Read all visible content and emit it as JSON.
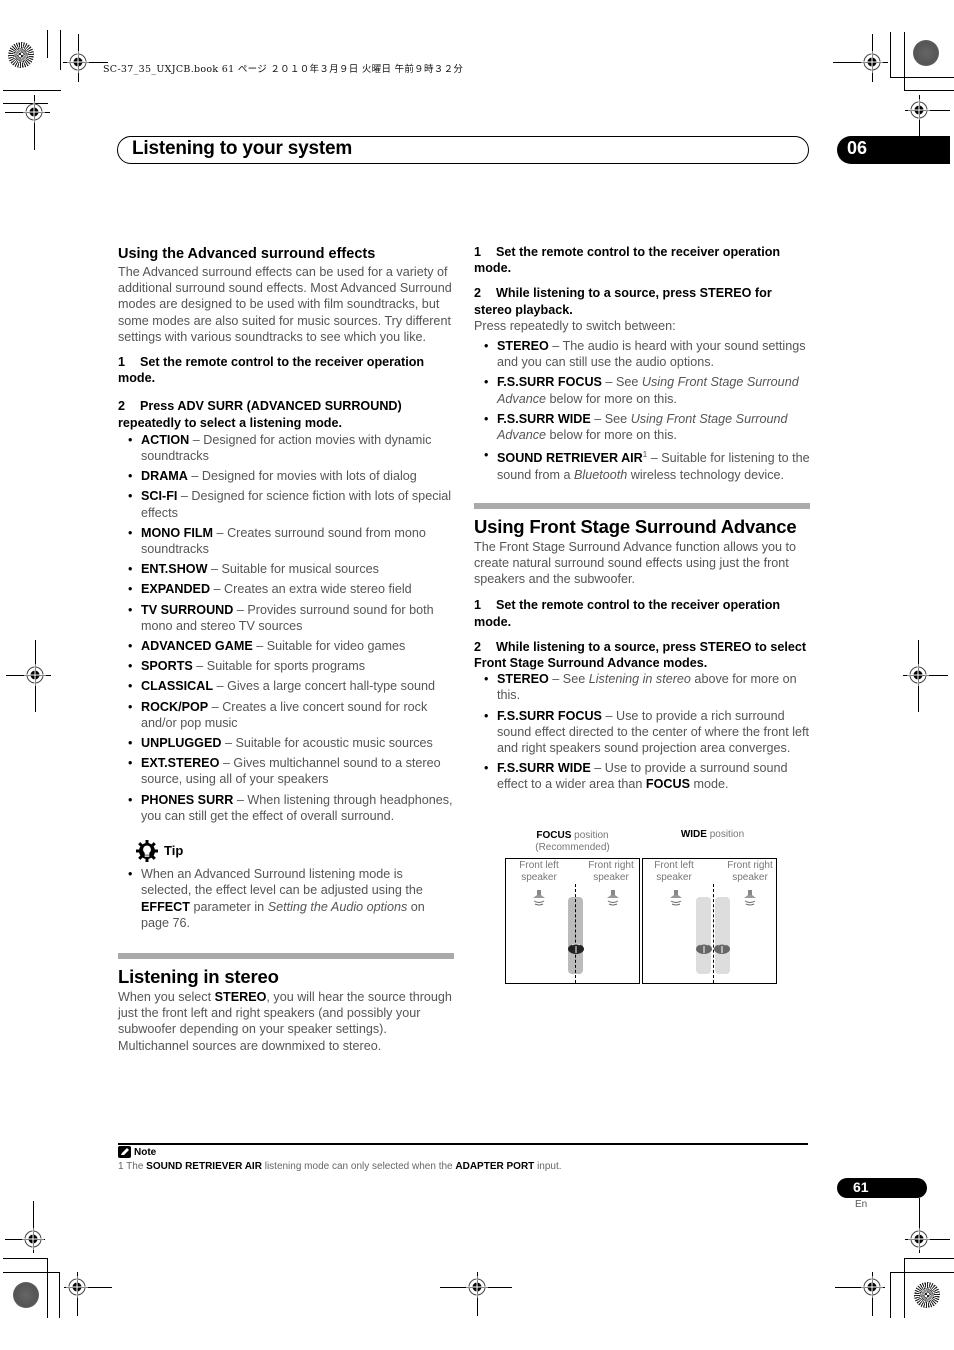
{
  "print_info": "SC-37_35_UXJCB.book  61 ページ  ２０１０年３月９日  火曜日  午前９時３２分",
  "header": {
    "title": "Listening to your system",
    "chapter": "06"
  },
  "left": {
    "adv_heading": "Using the Advanced surround effects",
    "adv_intro": "The Advanced surround effects can be used for a variety of additional surround sound effects. Most Advanced Surround modes are designed to be used with film soundtracks, but some modes are also suited for music sources. Try different settings with various soundtracks to see which you like.",
    "step1_num": "1",
    "step1": "Set the remote control to the receiver operation mode.",
    "step2_num": "2",
    "step2": "Press ADV SURR (ADVANCED SURROUND) repeatedly to select a listening mode.",
    "modes": [
      {
        "name": "ACTION",
        "desc": " – Designed for action movies with dynamic soundtracks"
      },
      {
        "name": "DRAMA",
        "desc": " – Designed for movies with lots of dialog"
      },
      {
        "name": "SCI-FI",
        "desc": " – Designed for science fiction with lots of special effects"
      },
      {
        "name": "MONO FILM",
        "desc": " – Creates surround sound from mono soundtracks"
      },
      {
        "name": "ENT.SHOW",
        "desc": " – Suitable for musical sources"
      },
      {
        "name": "EXPANDED",
        "desc": " – Creates an extra wide stereo field"
      },
      {
        "name": "TV SURROUND",
        "desc": " – Provides surround sound for both mono and stereo TV sources"
      },
      {
        "name": "ADVANCED GAME",
        "desc": " – Suitable for video games"
      },
      {
        "name": "SPORTS",
        "desc": " – Suitable for sports programs"
      },
      {
        "name": "CLASSICAL",
        "desc": " – Gives a large concert hall-type sound"
      },
      {
        "name": "ROCK/POP",
        "desc": " – Creates a live concert sound for rock and/or pop music"
      },
      {
        "name": "UNPLUGGED",
        "desc": " – Suitable for acoustic music sources"
      },
      {
        "name": "EXT.STEREO",
        "desc": " – Gives multichannel sound to a stereo source, using all of your speakers"
      },
      {
        "name": "PHONES SURR",
        "desc": " – When listening through headphones, you can still get the effect of overall surround."
      }
    ],
    "tip": {
      "label": "Tip",
      "text_1": "When an Advanced Surround listening mode is selected, the effect level can be adjusted using the ",
      "bold": "EFFECT",
      "text_2": " parameter in ",
      "link": "Setting the Audio options",
      "text_3": " on page 76."
    },
    "stereo_heading": "Listening in stereo",
    "stereo_text_1": "When you select ",
    "stereo_bold": "STEREO",
    "stereo_text_2": ", you will hear the source through just the front left and right speakers (and possibly your subwoofer depending on your speaker settings). Multichannel sources are downmixed to stereo."
  },
  "right": {
    "step1_num": "1",
    "step1": "Set the remote control to the receiver operation mode.",
    "step2_num": "2",
    "step2": "While listening to a source, press STEREO for stereo playback.",
    "press_text": "Press repeatedly to switch between:",
    "stereo_modes": [
      {
        "name": "STEREO",
        "desc": " – The audio is heard with your sound settings and you can still use the audio options."
      },
      {
        "name": "F.S.SURR FOCUS",
        "desc_1": " – See ",
        "link": "Using Front Stage Surround Advance",
        "desc_2": " below for more on this."
      },
      {
        "name": "F.S.SURR WIDE",
        "desc_1": " – See ",
        "link": "Using Front Stage Surround Advance",
        "desc_2": " below for more on this."
      },
      {
        "name": "SOUND RETRIEVER AIR",
        "sup": "1",
        "desc_1": " – Suitable for listening to the sound from a ",
        "link": "Bluetooth",
        "desc_2": " wireless technology device."
      }
    ],
    "fssa_heading": "Using Front Stage Surround Advance",
    "fssa_intro": "The Front Stage Surround Advance function allows you to create natural surround sound effects using just the front speakers and the subwoofer.",
    "fssa_step1_num": "1",
    "fssa_step1": "Set the remote control to the receiver operation mode.",
    "fssa_step2_num": "2",
    "fssa_step2": "While listening to a source, press STEREO to select Front Stage Surround Advance modes.",
    "fssa_modes": [
      {
        "name": "STEREO",
        "desc_1": " – See ",
        "link": "Listening in stereo",
        "desc_2": " above for more on this."
      },
      {
        "name": "F.S.SURR FOCUS",
        "desc_1": " – Use to provide a rich surround sound effect directed to the center of where the front left and right speakers sound projection area converges."
      },
      {
        "name": "F.S.SURR WIDE",
        "desc_1": " – Use to provide a surround sound effect to a wider area than ",
        "bold": "FOCUS",
        "desc_2": " mode."
      }
    ]
  },
  "diagram": {
    "focus_caption_bold": "FOCUS",
    "focus_caption": " position",
    "focus_caption_sub": "(Recommended)",
    "wide_caption_bold": "WIDE",
    "wide_caption": " position",
    "front_left_1": "Front left",
    "front_left_2": "speaker",
    "front_right_1": "Front right",
    "front_right_2": "speaker"
  },
  "footer": {
    "note_label": "Note",
    "note_1": "1 The ",
    "note_bold_1": "SOUND RETRIEVER AIR",
    "note_2": " listening mode can only selected when the ",
    "note_bold_2": "ADAPTER PORT",
    "note_3": " input.",
    "page_number": "61",
    "language": "En"
  }
}
